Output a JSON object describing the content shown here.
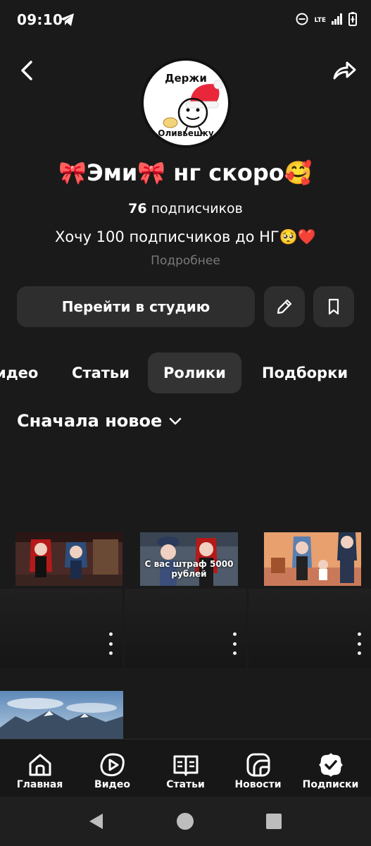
{
  "status_bar": {
    "time": "09:10",
    "network": "LTE"
  },
  "channel": {
    "avatar_top_text": "Держи",
    "avatar_bottom_text": "Оливьешку",
    "title": "🎀Эми🎀 нг скоро🥰",
    "subscribers_count": "76",
    "subscribers_label": "подписчиков",
    "description": "Хочу 100 подписчиков до НГ🥺❤️",
    "more_link": "Подробнее"
  },
  "actions": {
    "studio_label": "Перейти в студию"
  },
  "tabs": [
    "идео",
    "Статьи",
    "Ролики",
    "Подборки"
  ],
  "active_tab": "Ролики",
  "sort": {
    "label": "Сначала новое"
  },
  "thumbnails": {
    "second_caption": "С вас штраф 5000 рублей"
  },
  "bottom_nav": [
    {
      "label": "Главная",
      "icon": "home-icon"
    },
    {
      "label": "Видео",
      "icon": "video-play-icon"
    },
    {
      "label": "Статьи",
      "icon": "articles-book-icon"
    },
    {
      "label": "Новости",
      "icon": "news-icon"
    },
    {
      "label": "Подписки",
      "icon": "subscriptions-check-icon"
    }
  ],
  "colors": {
    "background": "#1a1a1a",
    "button_bg": "#2e2e2e",
    "muted_text": "#7a7a7a",
    "santa_hat": "#e8283a"
  }
}
